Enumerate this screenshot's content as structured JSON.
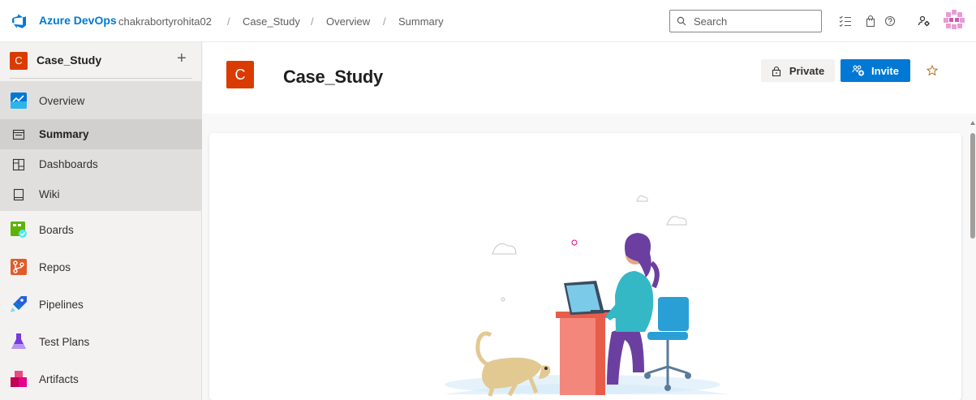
{
  "topbar": {
    "brand": "Azure DevOps",
    "breadcrumbs": [
      {
        "label": "chakrabortyrohita02"
      },
      {
        "label": "Case_Study"
      },
      {
        "label": "Overview"
      },
      {
        "label": "Summary"
      }
    ],
    "separator": "/",
    "search_placeholder": "Search",
    "icons": [
      "task-list-icon",
      "shopping-bag-icon",
      "help-icon",
      "user-settings-icon"
    ]
  },
  "sidebar": {
    "project_initial": "C",
    "project_name": "Case_Study",
    "add_symbol": "+",
    "items": [
      {
        "label": "Overview",
        "icon": "overview-icon"
      },
      {
        "label": "Summary",
        "icon": "summary-icon"
      },
      {
        "label": "Dashboards",
        "icon": "dashboards-icon"
      },
      {
        "label": "Wiki",
        "icon": "wiki-icon"
      },
      {
        "label": "Boards",
        "icon": "boards-icon"
      },
      {
        "label": "Repos",
        "icon": "repos-icon"
      },
      {
        "label": "Pipelines",
        "icon": "pipelines-icon"
      },
      {
        "label": "Test Plans",
        "icon": "test-plans-icon"
      },
      {
        "label": "Artifacts",
        "icon": "artifacts-icon"
      }
    ]
  },
  "main": {
    "project_initial": "C",
    "title": "Case_Study",
    "private_label": "Private",
    "invite_label": "Invite"
  },
  "colors": {
    "brand_blue": "#0078d4",
    "project_orange": "#da3b01"
  }
}
